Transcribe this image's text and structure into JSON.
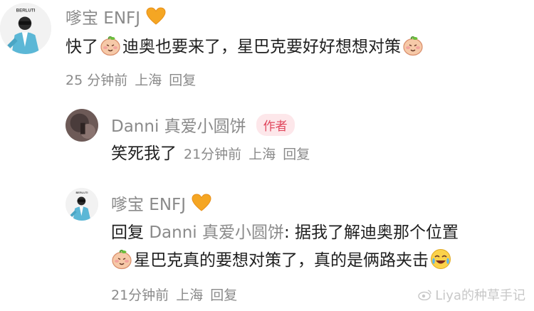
{
  "comments": [
    {
      "username": "嗲宝 ENFJ",
      "avatar_label": "BERLUTI",
      "body_parts": [
        "快了",
        "迪奥也要来了，星巴克要好好想想对策"
      ],
      "time": "25 分钟前",
      "location": "上海",
      "reply_label": "回复"
    },
    {
      "username": "Danni 真爱小圆饼",
      "badge": "作者",
      "body": "笑死我了",
      "time": "21分钟前",
      "location": "上海",
      "reply_label": "回复"
    },
    {
      "username": "嗲宝 ENFJ",
      "avatar_label": "BERLUTI",
      "reply_prefix": "回复",
      "reply_target": "Danni 真爱小圆饼",
      "body_line1": ": 据我了解迪奥那个位置",
      "body_line2": "星巴克真的要想对策了，真的是俩路夹击",
      "time": "21分钟前",
      "location": "上海",
      "reply_label": "回复"
    }
  ],
  "watermark": "Liya的种草手记",
  "colors": {
    "meta": "#8a8a8a",
    "badge_bg": "#fde7ea",
    "badge_text": "#e0475d",
    "heart": "#f5a623"
  },
  "icons": [
    "heart-icon",
    "peach-emoji-icon",
    "laugh-cry-emoji-icon",
    "weibo-logo-icon"
  ]
}
